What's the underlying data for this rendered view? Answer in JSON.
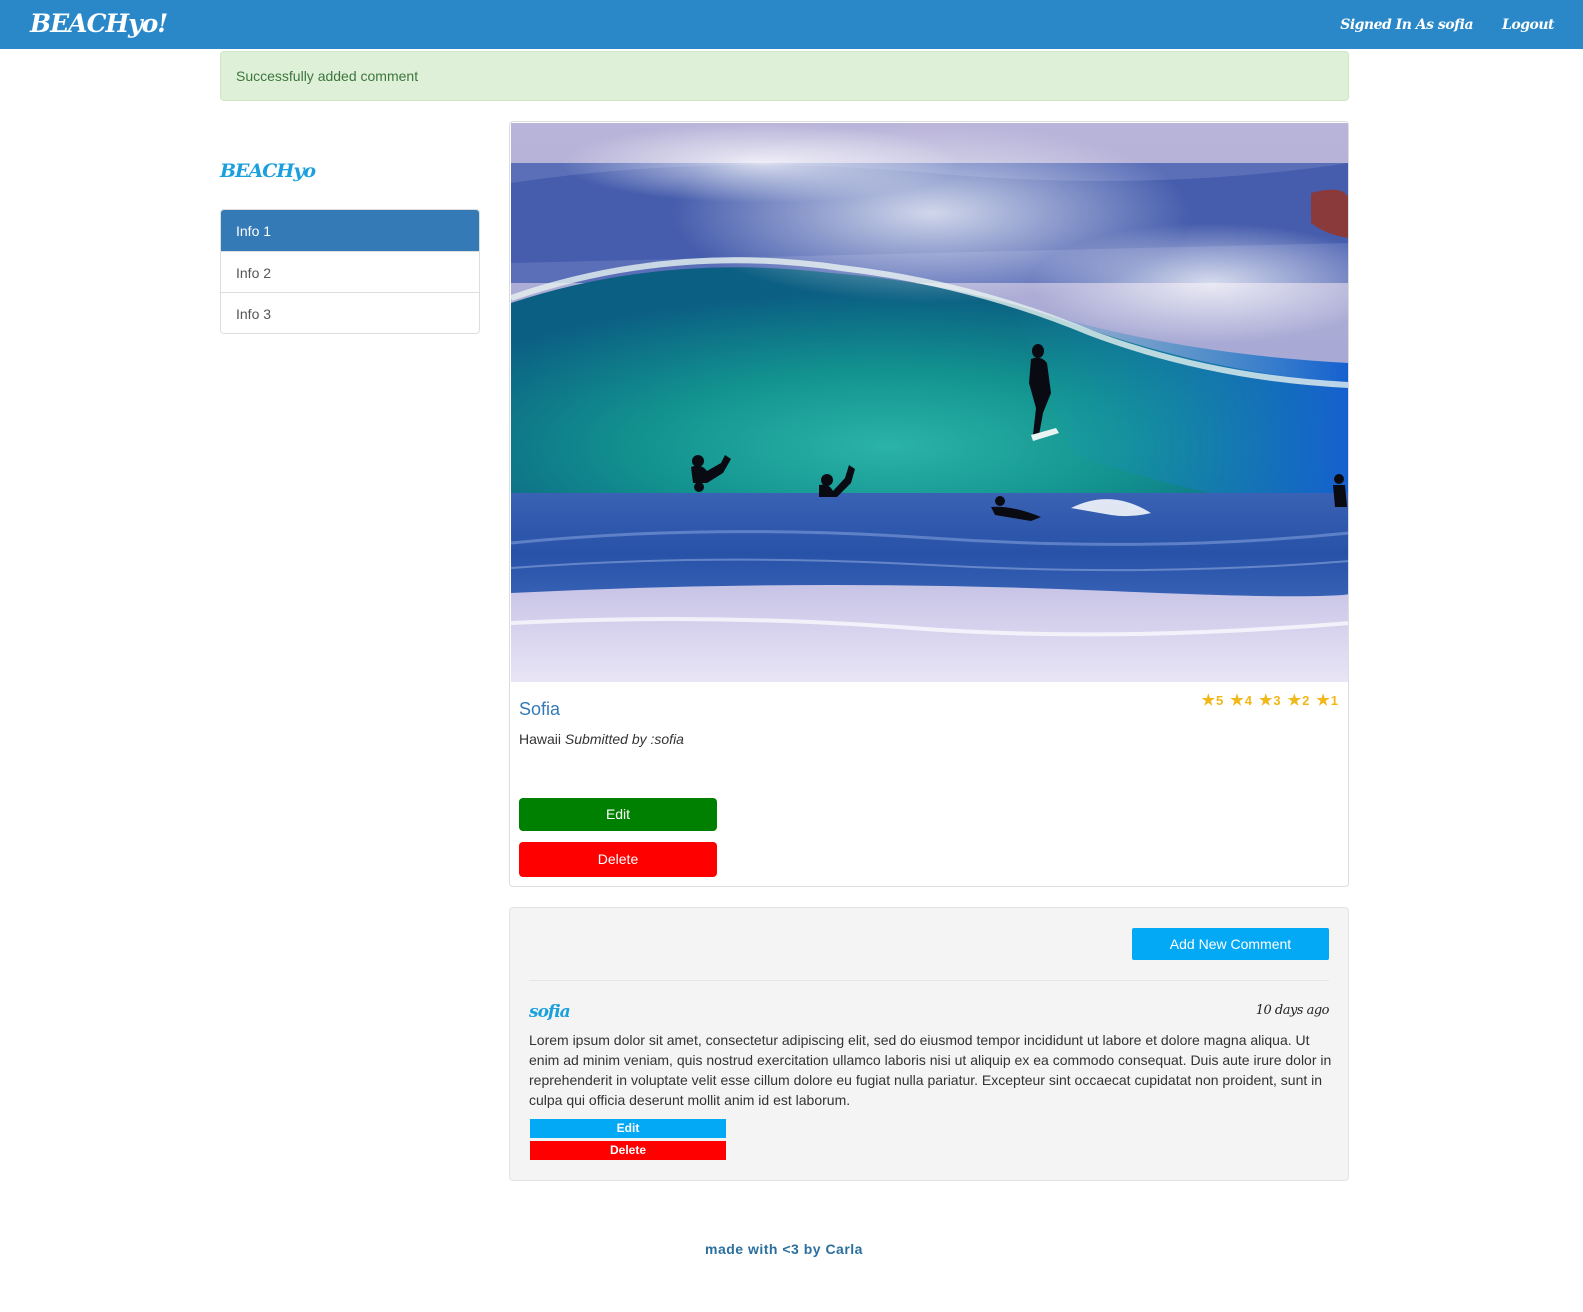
{
  "navbar": {
    "brand": "BEACHyo!",
    "signed_in": "Signed In As sofia",
    "logout": "Logout"
  },
  "alert": {
    "message": "Successfully added comment"
  },
  "sidebar": {
    "brand": "BEACHyo",
    "items": [
      {
        "label": "Info 1",
        "active": true
      },
      {
        "label": "Info 2",
        "active": false
      },
      {
        "label": "Info 3",
        "active": false
      }
    ]
  },
  "beach": {
    "title": "Sofia",
    "location": "Hawaii",
    "submitted_by": "Submitted by :sofia",
    "ratings": [
      {
        "icon": "star-icon",
        "value": "5"
      },
      {
        "icon": "star-icon",
        "value": "4"
      },
      {
        "icon": "star-icon",
        "value": "3"
      },
      {
        "icon": "star-icon",
        "value": "2"
      },
      {
        "icon": "star-icon",
        "value": "1"
      }
    ],
    "edit_label": "Edit",
    "delete_label": "Delete"
  },
  "comments": {
    "add_label": "Add New Comment",
    "items": [
      {
        "author": "sofia",
        "time": "10 days ago",
        "text": "Lorem ipsum dolor sit amet, consectetur adipiscing elit, sed do eiusmod tempor incididunt ut labore et dolore magna aliqua. Ut enim ad minim veniam, quis nostrud exercitation ullamco laboris nisi ut aliquip ex ea commodo consequat. Duis aute irure dolor in reprehenderit in voluptate velit esse cillum dolore eu fugiat nulla pariatur. Excepteur sint occaecat cupidatat non proident, sunt in culpa qui officia deserunt mollit anim id est laborum.",
        "edit_label": "Edit",
        "delete_label": "Delete"
      }
    ]
  },
  "footer": {
    "text": "made with <3 by Carla"
  },
  "colors": {
    "navbar": "#2a88c9",
    "accent": "#03a9f4",
    "edit": "#008000",
    "delete": "#ff0000",
    "star": "#f0b818"
  }
}
